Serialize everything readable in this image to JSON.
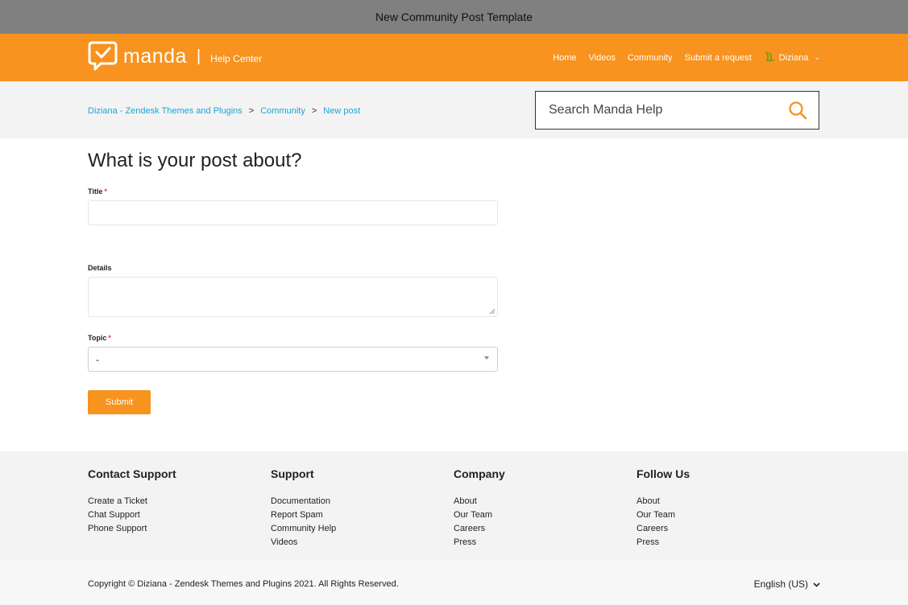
{
  "window": {
    "title": "New Community Post Template"
  },
  "header": {
    "logo_text": "manda",
    "logo_separator": "|",
    "logo_subtitle": "Help Center",
    "nav": [
      "Home",
      "Videos",
      "Community",
      "Submit a request"
    ],
    "user": "Diziana"
  },
  "breadcrumb": {
    "items": [
      "Diziana - Zendesk Themes and Plugins",
      "Community",
      "New post"
    ],
    "separator": ">"
  },
  "search": {
    "placeholder": "Search Manda Help"
  },
  "form": {
    "heading": "What is your post about?",
    "title_label": "Title",
    "details_label": "Details",
    "topic_label": "Topic",
    "required_mark": "*",
    "topic_value": "-",
    "submit_label": "Submit"
  },
  "footer": {
    "columns": [
      {
        "title": "Contact Support",
        "links": [
          "Create a Ticket",
          "Chat Support",
          "Phone Support"
        ]
      },
      {
        "title": "Support",
        "links": [
          "Documentation",
          "Report Spam",
          "Community Help",
          "Videos"
        ]
      },
      {
        "title": "Company",
        "links": [
          "About",
          "Our Team",
          "Careers",
          "Press"
        ]
      },
      {
        "title": "Follow Us",
        "links": [
          "About",
          "Our Team",
          "Careers",
          "Press"
        ]
      }
    ],
    "copyright": "Copyright © Diziana - Zendesk Themes and Plugins 2021. All Rights Reserved.",
    "language": "English (US)"
  },
  "colors": {
    "brand": "#f7931e",
    "link": "#1aa5d6",
    "required": "#e53935"
  },
  "icons": {
    "logo": "chat-check-icon",
    "user": "user-avatar-icon",
    "search": "search-icon",
    "dropdown": "chevron-down-icon"
  }
}
